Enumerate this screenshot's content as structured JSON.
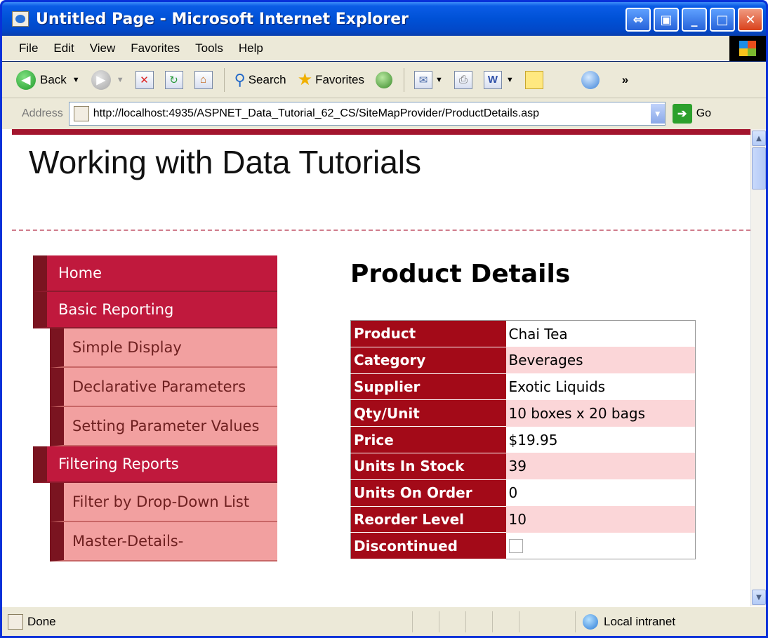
{
  "window": {
    "title": "Untitled Page - Microsoft Internet Explorer"
  },
  "menu": [
    "File",
    "Edit",
    "View",
    "Favorites",
    "Tools",
    "Help"
  ],
  "toolbar": {
    "back": "Back",
    "search": "Search",
    "favorites": "Favorites",
    "chevron": "»"
  },
  "address": {
    "label": "Address",
    "url": "http://localhost:4935/ASPNET_Data_Tutorial_62_CS/SiteMapProvider/ProductDetails.asp",
    "go": "Go"
  },
  "page": {
    "site_title": "Working with Data Tutorials",
    "heading": "Product Details",
    "nav": {
      "home": "Home",
      "basic": "Basic Reporting",
      "basic_items": [
        "Simple Display",
        "Declarative Parameters",
        "Setting Parameter Values"
      ],
      "filtering": "Filtering Reports",
      "filtering_items": [
        "Filter by Drop-Down List",
        "Master-Details-"
      ]
    },
    "details": [
      {
        "label": "Product",
        "value": "Chai Tea"
      },
      {
        "label": "Category",
        "value": "Beverages"
      },
      {
        "label": "Supplier",
        "value": "Exotic Liquids"
      },
      {
        "label": "Qty/Unit",
        "value": "10 boxes x 20 bags"
      },
      {
        "label": "Price",
        "value": "$19.95"
      },
      {
        "label": "Units In Stock",
        "value": "39"
      },
      {
        "label": "Units On Order",
        "value": "0"
      },
      {
        "label": "Reorder Level",
        "value": "10"
      },
      {
        "label": "Discontinued",
        "value": ""
      }
    ]
  },
  "status": {
    "text": "Done",
    "zone": "Local intranet"
  },
  "colors": {
    "accent": "#a30a18",
    "nav": "#c0193d",
    "nav_sub": "#f2a0a0"
  }
}
